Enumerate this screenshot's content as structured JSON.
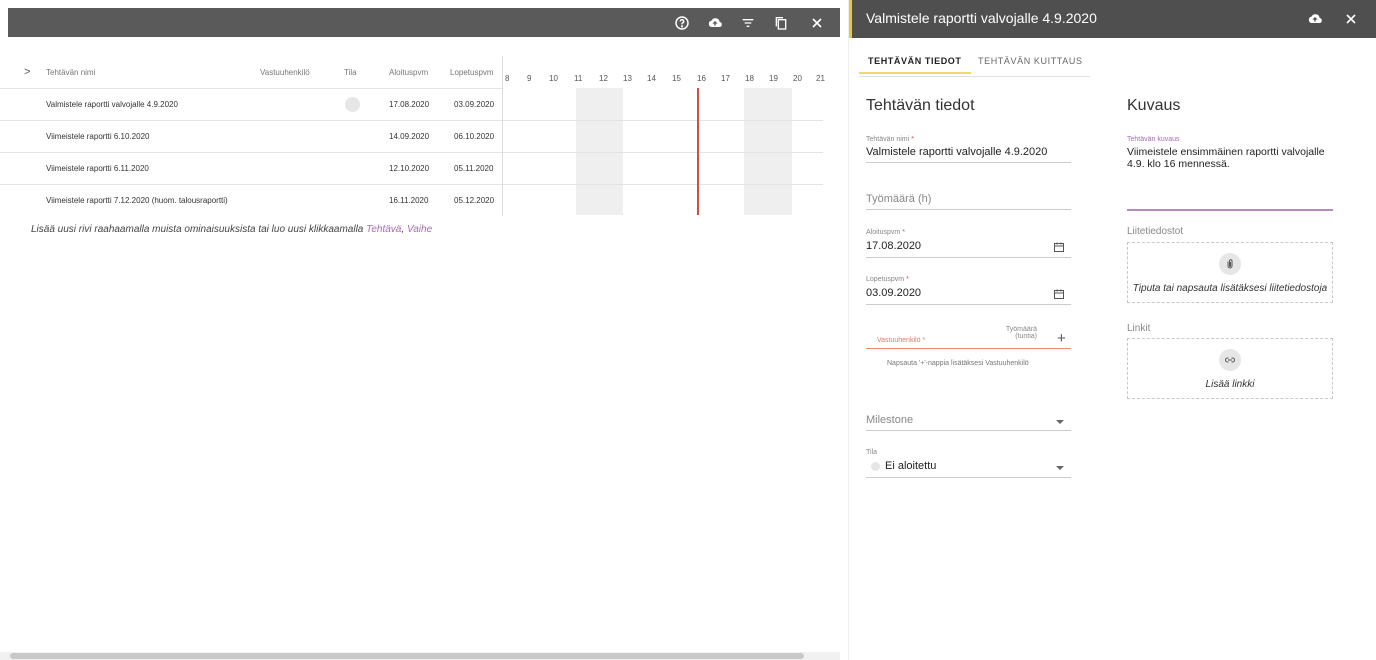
{
  "toolbar": {
    "icons": [
      "help-icon",
      "cloud-upload-icon",
      "filter-icon",
      "copy-icon",
      "close-icon"
    ]
  },
  "grid": {
    "headers": {
      "name": "Tehtävän nimi",
      "owner": "Vastuuhenkilö",
      "status": "Tila",
      "start": "Aloituspvm",
      "end": "Lopetuspvm"
    },
    "rows": [
      {
        "name": "Valmistele raportti valvojalle 4.9.2020",
        "start": "17.08.2020",
        "end": "03.09.2020",
        "has_status": true
      },
      {
        "name": "Viimeistele raportti 6.10.2020",
        "start": "14.09.2020",
        "end": "06.10.2020",
        "has_status": false
      },
      {
        "name": "Viimeistele raportti 6.11.2020",
        "start": "12.10.2020",
        "end": "05.11.2020",
        "has_status": false
      },
      {
        "name": "Viimeistele raportti 7.12.2020 (huom. talousraportti)",
        "start": "16.11.2020",
        "end": "05.12.2020",
        "has_status": false
      }
    ],
    "hours": [
      "8",
      "9",
      "10",
      "11",
      "12",
      "13",
      "14",
      "15",
      "16",
      "17",
      "18",
      "19",
      "20",
      "21"
    ]
  },
  "hint": {
    "text": "Lisää uusi rivi raahaamalla muista ominaisuuksista tai luo uusi klikkaamalla ",
    "link1": "Tehtävä",
    "separator": ", ",
    "link2": "Vaihe"
  },
  "panel": {
    "title": "Valmistele raportti valvojalle 4.9.2020",
    "tabs": [
      "TEHTÄVÄN TIEDOT",
      "TEHTÄVÄN KUITTAUS"
    ],
    "details_title": "Tehtävän tiedot",
    "name_label": "Tehtävän nimi",
    "name_value": "Valmistele raportti valvojalle 4.9.2020",
    "workload_placeholder": "Työmäärä (h)",
    "start_label": "Aloituspvm",
    "start_value": "17.08.2020",
    "end_label": "Lopetuspvm",
    "end_value": "03.09.2020",
    "owner_label": "Vastuuhenkilö",
    "workload_col_label_1": "Työmäärä",
    "workload_col_label_2": "(tuntia)",
    "add_symbol": "+",
    "owner_hint": "Napsauta '+'-nappia lisätäksesi Vastuuhenkilö",
    "milestone_placeholder": "Milestone",
    "status_label": "Tila",
    "status_value": "Ei aloitettu",
    "required_mark": "*",
    "description_title": "Kuvaus",
    "description_label": "Tehtävän kuvaus",
    "description_value": "Viimeistele ensimmäinen raportti valvojalle 4.9. klo 16 mennessä.",
    "attachments_label": "Liitetiedostot",
    "attachments_drop": "Tiputa tai napsauta lisätäksesi liitetiedostoja",
    "links_label": "Linkit",
    "links_add": "Lisää linkki"
  },
  "colors": {
    "toolbar_bg": "#5a5a5a",
    "panel_header_bg": "#4f4f4f",
    "accent_yellow": "#f4c430",
    "link_purple": "#b068b8",
    "today_line": "#c8533a",
    "required_red": "#e04848"
  }
}
